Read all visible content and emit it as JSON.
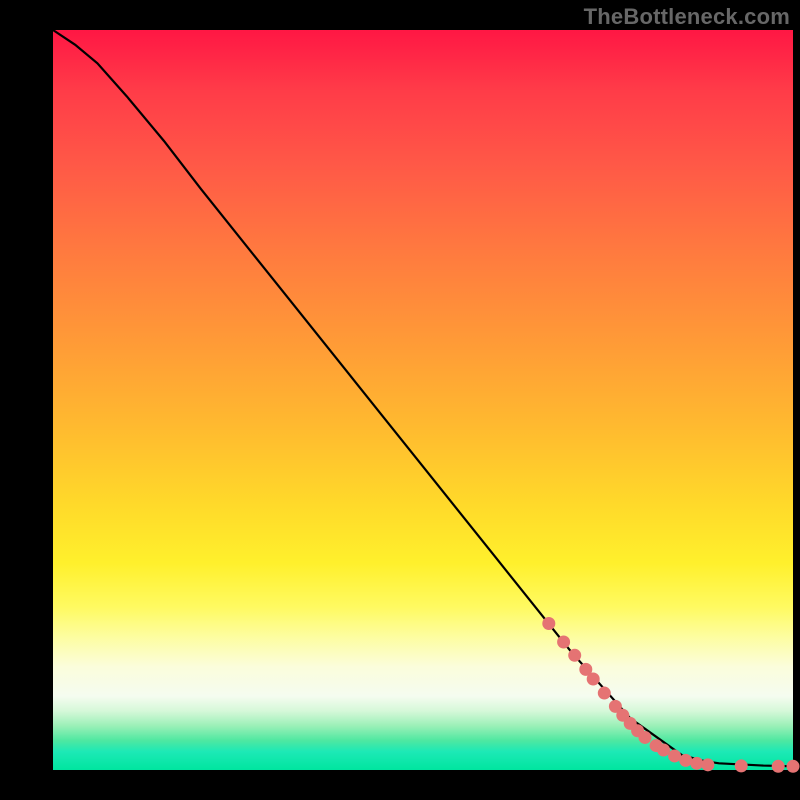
{
  "watermark": "TheBottleneck.com",
  "chart_data": {
    "type": "line",
    "title": "",
    "xlabel": "",
    "ylabel": "",
    "x_range": [
      0,
      100
    ],
    "y_range": [
      0,
      100
    ],
    "series": [
      {
        "name": "curve",
        "x": [
          0,
          3,
          6,
          10,
          15,
          20,
          30,
          40,
          50,
          60,
          70,
          78,
          85,
          88,
          90,
          92,
          94,
          96,
          98,
          100
        ],
        "y": [
          100,
          98,
          95.5,
          91,
          85,
          78.5,
          66,
          53.5,
          41,
          28.5,
          16,
          7,
          2,
          1.2,
          0.9,
          0.8,
          0.7,
          0.6,
          0.55,
          0.5
        ]
      }
    ],
    "markers": {
      "name": "highlighted-points",
      "points": [
        {
          "x": 67,
          "y": 19.8
        },
        {
          "x": 69,
          "y": 17.3
        },
        {
          "x": 70.5,
          "y": 15.5
        },
        {
          "x": 72,
          "y": 13.6
        },
        {
          "x": 73,
          "y": 12.3
        },
        {
          "x": 74.5,
          "y": 10.4
        },
        {
          "x": 76,
          "y": 8.6
        },
        {
          "x": 77,
          "y": 7.4
        },
        {
          "x": 78,
          "y": 6.3
        },
        {
          "x": 79,
          "y": 5.3
        },
        {
          "x": 80,
          "y": 4.4
        },
        {
          "x": 81.5,
          "y": 3.3
        },
        {
          "x": 82.5,
          "y": 2.7
        },
        {
          "x": 84,
          "y": 1.9
        },
        {
          "x": 85.5,
          "y": 1.3
        },
        {
          "x": 87,
          "y": 0.9
        },
        {
          "x": 88.5,
          "y": 0.7
        },
        {
          "x": 93,
          "y": 0.55
        },
        {
          "x": 98,
          "y": 0.5
        },
        {
          "x": 100,
          "y": 0.5
        }
      ]
    }
  }
}
